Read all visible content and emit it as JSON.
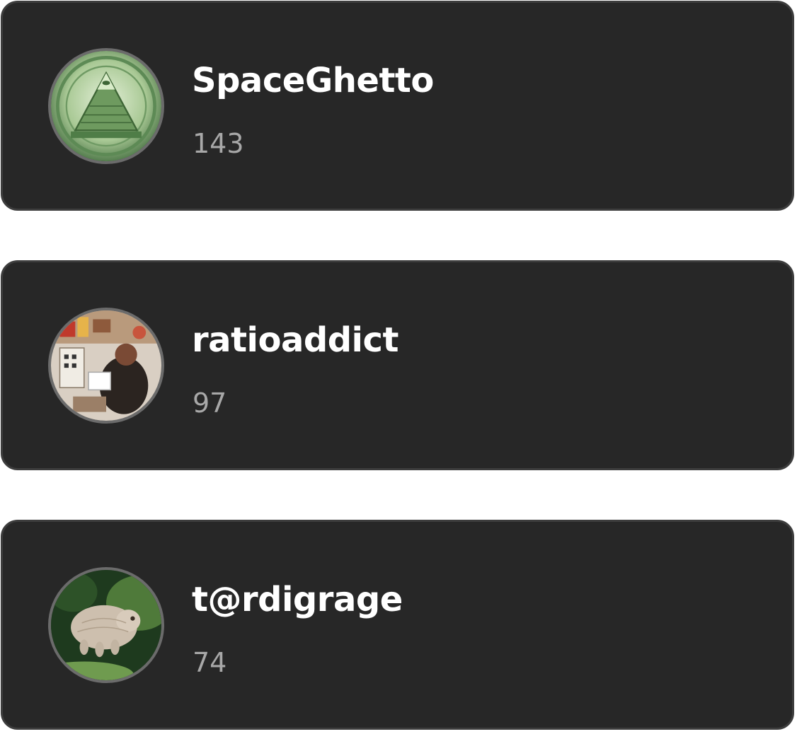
{
  "leaderboard": {
    "entries": [
      {
        "username": "SpaceGhetto",
        "count": "143",
        "avatar_icon": "pyramid-seal-avatar"
      },
      {
        "username": "ratioaddict",
        "count": "97",
        "avatar_icon": "collage-photo-avatar"
      },
      {
        "username": "t@rdigrage",
        "count": "74",
        "avatar_icon": "tardigrade-avatar"
      }
    ]
  }
}
